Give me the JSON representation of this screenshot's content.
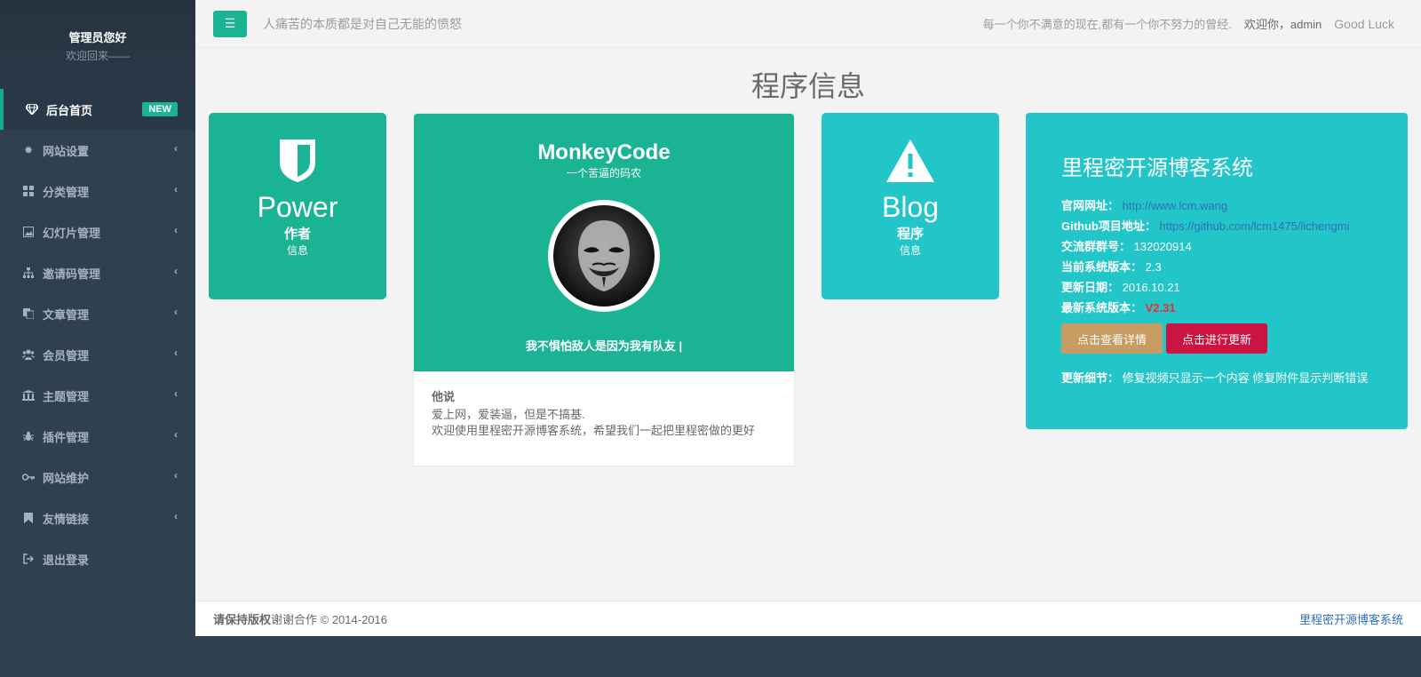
{
  "sidebar": {
    "profile": {
      "name": "管理员您好",
      "welcome": "欢迎回来——"
    },
    "items": [
      {
        "label": "后台首页",
        "icon": "diamond-icon",
        "badge": "NEW",
        "active": true
      },
      {
        "label": "网站设置",
        "icon": "gear-icon"
      },
      {
        "label": "分类管理",
        "icon": "grid-icon"
      },
      {
        "label": "幻灯片管理",
        "icon": "image-icon"
      },
      {
        "label": "邀请码管理",
        "icon": "sitemap-icon"
      },
      {
        "label": "文章管理",
        "icon": "copy-icon"
      },
      {
        "label": "会员管理",
        "icon": "users-icon"
      },
      {
        "label": "主题管理",
        "icon": "bank-icon"
      },
      {
        "label": "插件管理",
        "icon": "bug-icon"
      },
      {
        "label": "网站维护",
        "icon": "key-icon"
      },
      {
        "label": "友情链接",
        "icon": "bookmark-icon"
      },
      {
        "label": "退出登录",
        "icon": "signout-icon"
      }
    ]
  },
  "topbar": {
    "tagline": "人痛苦的本质都是对自己无能的愤怒",
    "motto": "每一个你不满意的现在,都有一个你不努力的曾经.",
    "hello": "欢迎你，admin",
    "luck": "Good Luck"
  },
  "page_title": "程序信息",
  "power_card": {
    "big": "Power",
    "bold": "作者",
    "small": "信息"
  },
  "blog_card": {
    "big": "Blog",
    "bold": "程序",
    "small": "信息"
  },
  "profile_card": {
    "name": "MonkeyCode",
    "subtitle": "一个苦逼的码农",
    "quote": "我不惧怕敌人是因为我有队友 |",
    "says_title": "他说",
    "line1": "爱上网，爱装逼，但是不搞基.",
    "line2": "欢迎使用里程密开源博客系统，希望我们一起把里程密做的更好"
  },
  "info_card": {
    "title": "里程密开源博客系统",
    "website_key": "官网网址：",
    "website_val": "http://www.lcm.wang",
    "github_key": "Github项目地址：",
    "github_val": "https://github.com/lcm1475/lichengmi",
    "group_key": "交流群群号：",
    "group_val": "132020914",
    "version_key": "当前系统版本：",
    "version_val": "2.3",
    "date_key": "更新日期：",
    "date_val": "2016.10.21",
    "latest_key": "最新系统版本：",
    "latest_val": "V2.31",
    "btn_detail": "点击查看详情",
    "btn_update": "点击进行更新",
    "detail_key": "更新细节：",
    "detail_val": "修复视频只显示一个内容 修复附件显示判断错误"
  },
  "footer": {
    "bold": "请保持版权",
    "text": "谢谢合作 © 2014-2016",
    "right": "里程密开源博客系统"
  },
  "colors": {
    "accent": "#1ab394",
    "info": "#23c6c8",
    "sidebar": "#2f4050",
    "danger": "#cc1443",
    "warning": "#c89b63"
  }
}
